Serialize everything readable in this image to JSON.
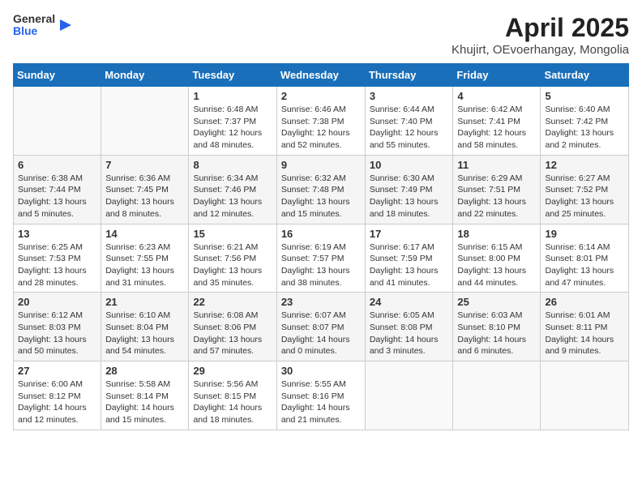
{
  "header": {
    "logo_general": "General",
    "logo_blue": "Blue",
    "title": "April 2025",
    "subtitle": "Khujirt, OEvoerhangay, Mongolia"
  },
  "days_of_week": [
    "Sunday",
    "Monday",
    "Tuesday",
    "Wednesday",
    "Thursday",
    "Friday",
    "Saturday"
  ],
  "weeks": [
    [
      {
        "day": "",
        "detail": ""
      },
      {
        "day": "",
        "detail": ""
      },
      {
        "day": "1",
        "detail": "Sunrise: 6:48 AM\nSunset: 7:37 PM\nDaylight: 12 hours and 48 minutes."
      },
      {
        "day": "2",
        "detail": "Sunrise: 6:46 AM\nSunset: 7:38 PM\nDaylight: 12 hours and 52 minutes."
      },
      {
        "day": "3",
        "detail": "Sunrise: 6:44 AM\nSunset: 7:40 PM\nDaylight: 12 hours and 55 minutes."
      },
      {
        "day": "4",
        "detail": "Sunrise: 6:42 AM\nSunset: 7:41 PM\nDaylight: 12 hours and 58 minutes."
      },
      {
        "day": "5",
        "detail": "Sunrise: 6:40 AM\nSunset: 7:42 PM\nDaylight: 13 hours and 2 minutes."
      }
    ],
    [
      {
        "day": "6",
        "detail": "Sunrise: 6:38 AM\nSunset: 7:44 PM\nDaylight: 13 hours and 5 minutes."
      },
      {
        "day": "7",
        "detail": "Sunrise: 6:36 AM\nSunset: 7:45 PM\nDaylight: 13 hours and 8 minutes."
      },
      {
        "day": "8",
        "detail": "Sunrise: 6:34 AM\nSunset: 7:46 PM\nDaylight: 13 hours and 12 minutes."
      },
      {
        "day": "9",
        "detail": "Sunrise: 6:32 AM\nSunset: 7:48 PM\nDaylight: 13 hours and 15 minutes."
      },
      {
        "day": "10",
        "detail": "Sunrise: 6:30 AM\nSunset: 7:49 PM\nDaylight: 13 hours and 18 minutes."
      },
      {
        "day": "11",
        "detail": "Sunrise: 6:29 AM\nSunset: 7:51 PM\nDaylight: 13 hours and 22 minutes."
      },
      {
        "day": "12",
        "detail": "Sunrise: 6:27 AM\nSunset: 7:52 PM\nDaylight: 13 hours and 25 minutes."
      }
    ],
    [
      {
        "day": "13",
        "detail": "Sunrise: 6:25 AM\nSunset: 7:53 PM\nDaylight: 13 hours and 28 minutes."
      },
      {
        "day": "14",
        "detail": "Sunrise: 6:23 AM\nSunset: 7:55 PM\nDaylight: 13 hours and 31 minutes."
      },
      {
        "day": "15",
        "detail": "Sunrise: 6:21 AM\nSunset: 7:56 PM\nDaylight: 13 hours and 35 minutes."
      },
      {
        "day": "16",
        "detail": "Sunrise: 6:19 AM\nSunset: 7:57 PM\nDaylight: 13 hours and 38 minutes."
      },
      {
        "day": "17",
        "detail": "Sunrise: 6:17 AM\nSunset: 7:59 PM\nDaylight: 13 hours and 41 minutes."
      },
      {
        "day": "18",
        "detail": "Sunrise: 6:15 AM\nSunset: 8:00 PM\nDaylight: 13 hours and 44 minutes."
      },
      {
        "day": "19",
        "detail": "Sunrise: 6:14 AM\nSunset: 8:01 PM\nDaylight: 13 hours and 47 minutes."
      }
    ],
    [
      {
        "day": "20",
        "detail": "Sunrise: 6:12 AM\nSunset: 8:03 PM\nDaylight: 13 hours and 50 minutes."
      },
      {
        "day": "21",
        "detail": "Sunrise: 6:10 AM\nSunset: 8:04 PM\nDaylight: 13 hours and 54 minutes."
      },
      {
        "day": "22",
        "detail": "Sunrise: 6:08 AM\nSunset: 8:06 PM\nDaylight: 13 hours and 57 minutes."
      },
      {
        "day": "23",
        "detail": "Sunrise: 6:07 AM\nSunset: 8:07 PM\nDaylight: 14 hours and 0 minutes."
      },
      {
        "day": "24",
        "detail": "Sunrise: 6:05 AM\nSunset: 8:08 PM\nDaylight: 14 hours and 3 minutes."
      },
      {
        "day": "25",
        "detail": "Sunrise: 6:03 AM\nSunset: 8:10 PM\nDaylight: 14 hours and 6 minutes."
      },
      {
        "day": "26",
        "detail": "Sunrise: 6:01 AM\nSunset: 8:11 PM\nDaylight: 14 hours and 9 minutes."
      }
    ],
    [
      {
        "day": "27",
        "detail": "Sunrise: 6:00 AM\nSunset: 8:12 PM\nDaylight: 14 hours and 12 minutes."
      },
      {
        "day": "28",
        "detail": "Sunrise: 5:58 AM\nSunset: 8:14 PM\nDaylight: 14 hours and 15 minutes."
      },
      {
        "day": "29",
        "detail": "Sunrise: 5:56 AM\nSunset: 8:15 PM\nDaylight: 14 hours and 18 minutes."
      },
      {
        "day": "30",
        "detail": "Sunrise: 5:55 AM\nSunset: 8:16 PM\nDaylight: 14 hours and 21 minutes."
      },
      {
        "day": "",
        "detail": ""
      },
      {
        "day": "",
        "detail": ""
      },
      {
        "day": "",
        "detail": ""
      }
    ]
  ]
}
